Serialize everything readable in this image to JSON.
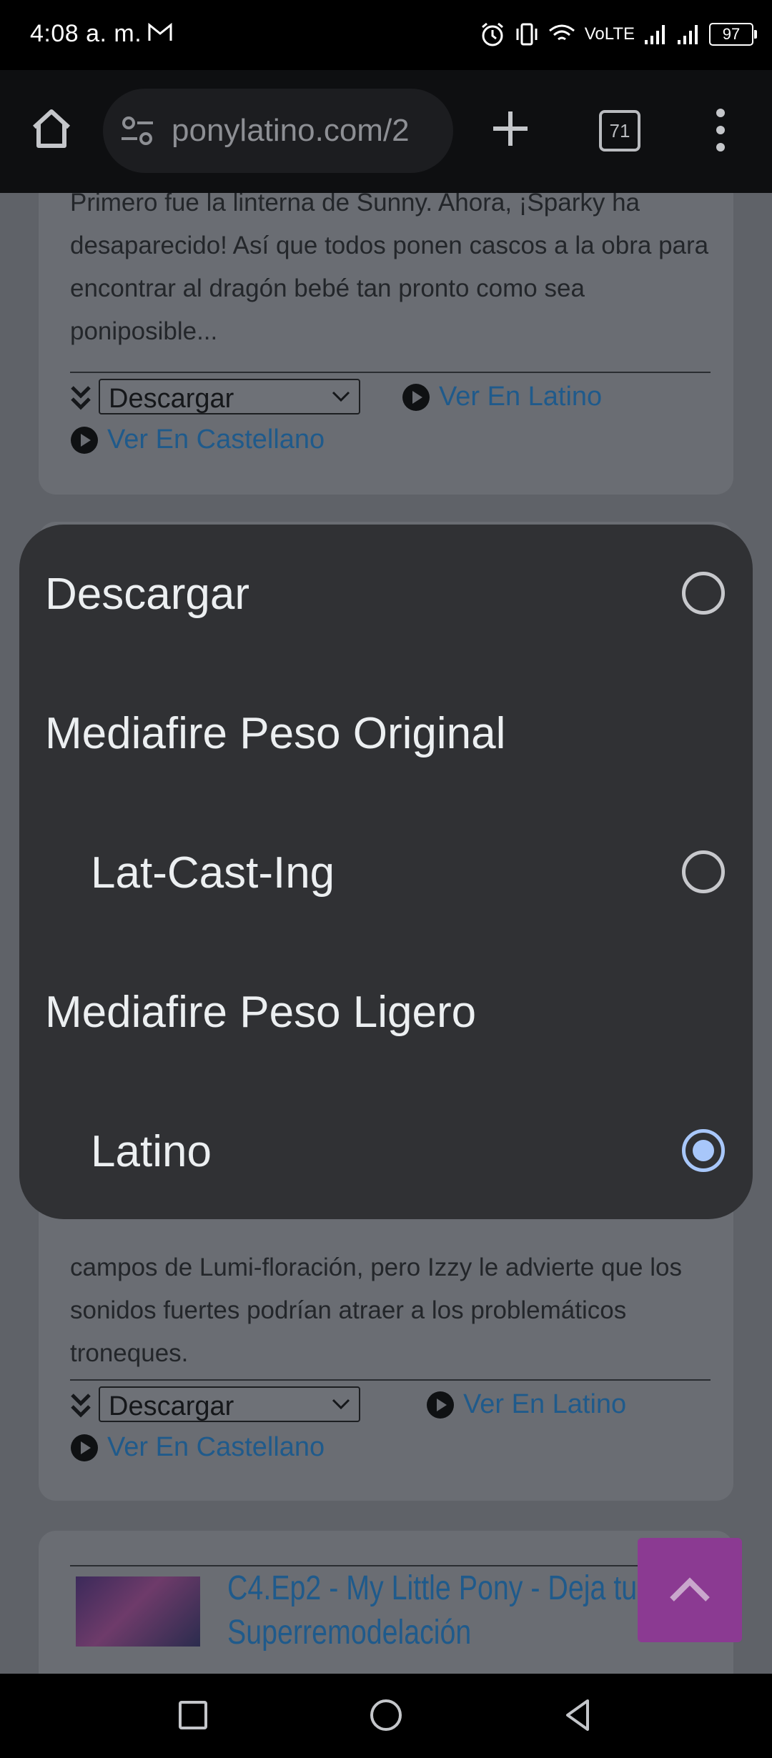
{
  "status_bar": {
    "time": "4:08 a. m.",
    "network": "VoLTE",
    "battery": "97",
    "icons": [
      "gmail-icon",
      "alarm-icon",
      "vibrate-icon",
      "wifi-icon",
      "signal-icon",
      "signal-icon",
      "battery-icon"
    ]
  },
  "browser": {
    "url": "ponylatino.com/2",
    "tab_count": "71",
    "icons": [
      "home-icon",
      "site-settings-icon",
      "new-tab-icon",
      "tabs-icon",
      "more-options-icon"
    ]
  },
  "page": {
    "card1": {
      "description": "Primero fue la linterna de Sunny. Ahora, ¡Sparky ha desaparecido! Así que todos ponen cascos a la obra para encontrar al dragón bebé tan pronto como sea poniposible...",
      "download_select": "Descargar",
      "link_latino": "Ver En Latino",
      "link_castellano": "Ver En Castellano"
    },
    "card2": {
      "description_tail": "campos de Lumi-floración, pero Izzy le advierte que los sonidos fuertes podrían atraer a los problemáticos troneques.",
      "download_select": "Descargar",
      "link_latino": "Ver En Latino",
      "link_castellano": "Ver En Castellano"
    },
    "card3": {
      "title": "C4.Ep2 - My Little Pony - Deja tu marca - Superremodelación"
    }
  },
  "dropdown": {
    "options": [
      {
        "label": "Descargar",
        "type": "option",
        "selected": false
      },
      {
        "label": "Mediafire Peso Original",
        "type": "group"
      },
      {
        "label": "Lat-Cast-Ing",
        "type": "option",
        "selected": false
      },
      {
        "label": "Mediafire Peso Ligero",
        "type": "group"
      },
      {
        "label": "Latino",
        "type": "option",
        "selected": true
      }
    ]
  },
  "colors": {
    "dialog_bg": "#303134",
    "radio_selected": "#a8c7fa",
    "link": "#1f5a8b",
    "scroll_top_button": "#8b3a92"
  }
}
